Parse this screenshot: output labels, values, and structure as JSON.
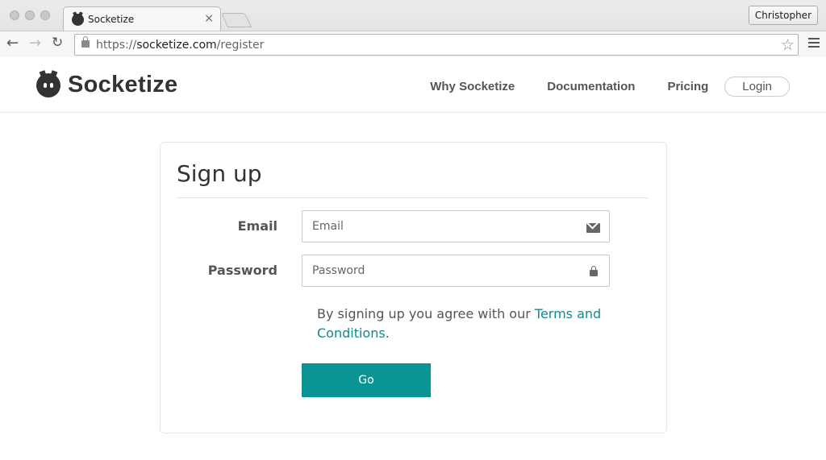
{
  "browser": {
    "tab_title": "Socketize",
    "tab_close": "×",
    "profile_name": "Christopher",
    "url_scheme": "https://",
    "url_host": "socketize.com",
    "url_path": "/register",
    "icons": [
      "back-arrow-icon",
      "forward-arrow-icon",
      "reload-icon",
      "lock-icon",
      "star-icon",
      "menu-icon"
    ]
  },
  "site": {
    "brand": "Socketize",
    "nav": {
      "why": "Why Socketize",
      "docs": "Documentation",
      "pricing": "Pricing",
      "login": "Login"
    }
  },
  "signup": {
    "title": "Sign up",
    "email_label": "Email",
    "email_placeholder": "Email",
    "password_label": "Password",
    "password_placeholder": "Password",
    "terms_prefix": "By signing up you agree with our ",
    "terms_link": "Terms and Conditions",
    "terms_suffix": ".",
    "submit_label": "Go"
  },
  "colors": {
    "accent": "#0a9494",
    "link": "#16888a"
  }
}
